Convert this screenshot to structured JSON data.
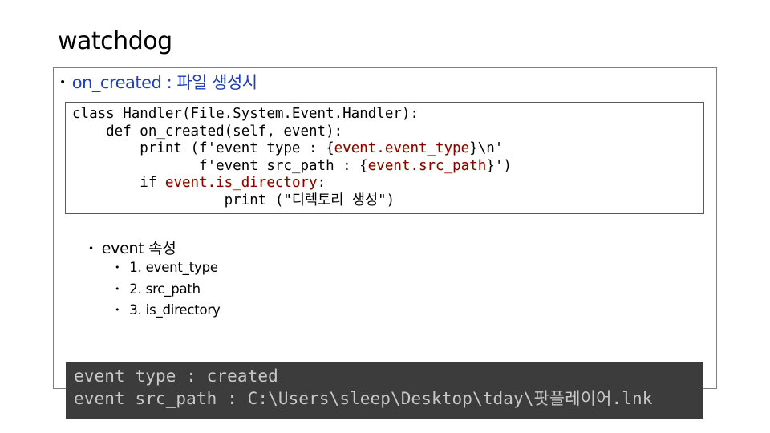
{
  "slide": {
    "title": "watchdog"
  },
  "main_bullet": {
    "text": "on_created : 파일 생성시"
  },
  "code": {
    "lines": [
      {
        "pre": "class Handler(File.System.Event.Handler):",
        "hl": "",
        "post": ""
      },
      {
        "pre": "    def on_created(self, event):",
        "hl": "",
        "post": ""
      },
      {
        "pre": "        print (f'event type : {",
        "hl": "event.event_type",
        "post": "}\\n'"
      },
      {
        "pre": "               f'event src_path : {",
        "hl": "event.src_path",
        "post": "}')"
      },
      {
        "pre": "        if ",
        "hl": "event.is_directory",
        "post": ":"
      },
      {
        "pre": "                  print (\"디렉토리 생성\")",
        "hl": "",
        "post": ""
      }
    ]
  },
  "sub_bullet": {
    "text": "event 속성"
  },
  "attributes": [
    "1. event_type",
    "2. src_path",
    "3. is_directory"
  ],
  "console": {
    "lines": [
      "event type : created",
      "event src_path : C:\\Users\\sleep\\Desktop\\tday\\팟플레이어.lnk"
    ]
  },
  "colors": {
    "bullet_text": "#1f3fb4",
    "highlight": "#8b0000",
    "console_bg": "#3c3c3c",
    "console_text": "#c8c8c8"
  }
}
